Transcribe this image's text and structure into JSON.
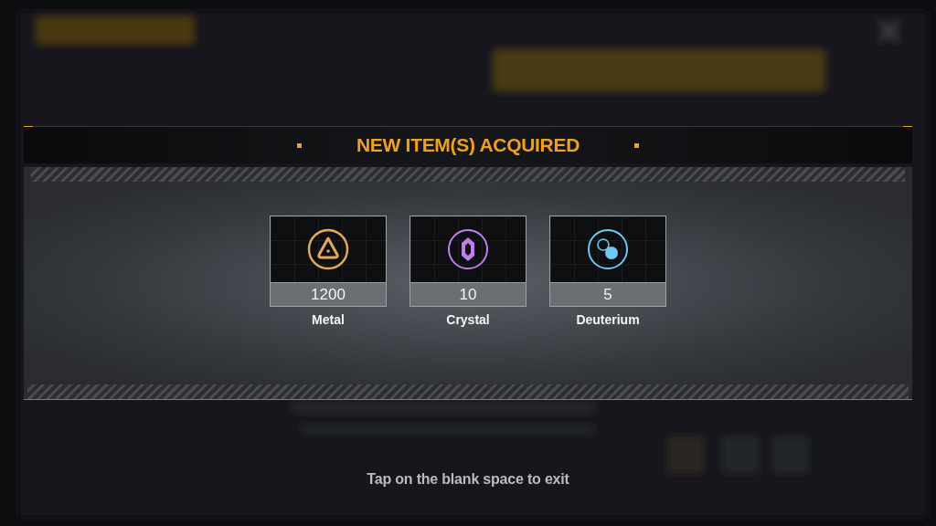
{
  "title": "NEW ITEM(S) ACQUIRED",
  "items": [
    {
      "kind": "metal",
      "amount": "1200",
      "name": "Metal",
      "color": "#e2a95c"
    },
    {
      "kind": "crystal",
      "amount": "10",
      "name": "Crystal",
      "color": "#c27cf0"
    },
    {
      "kind": "deuterium",
      "amount": "5",
      "name": "Deuterium",
      "color": "#6cc8ee"
    }
  ],
  "hint": "Tap on the blank space to exit"
}
